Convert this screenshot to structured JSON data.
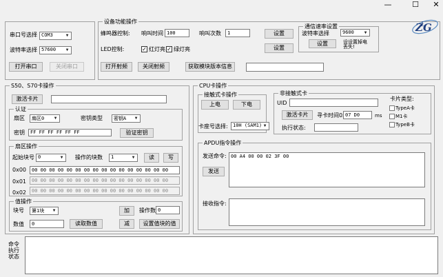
{
  "window": {
    "minimize_glyph": "—",
    "maximize_glyph": "☐",
    "close_glyph": "✕"
  },
  "serial": {
    "port_label": "串口号选择",
    "port_value": "COM3",
    "baud_label": "波特率选择",
    "baud_value": "57600",
    "open_label": "打开串口",
    "close_label": "关闭串口"
  },
  "device": {
    "title": "设备功能操作",
    "buzzer_label": "蜂鸣器控制:",
    "time_label": "响叫时间",
    "time_value": "100",
    "count_label": "响叫次数",
    "count_value": "1",
    "set_label": "设置",
    "led_label": "LED控制:",
    "red_label": "红灯亮",
    "green_label": "绿灯亮",
    "led_set_label": "设置",
    "rf_on_label": "打开射频",
    "rf_off_label": "关闭射频",
    "version_label": "获取模块版本信息",
    "version_value": ""
  },
  "comm": {
    "title": "通信速率设置",
    "baud_label": "波特率选择",
    "baud_value": "9600",
    "set_label": "设置",
    "note_text": "设设置掉电丢失!"
  },
  "s50": {
    "title": "S50、S70卡操作",
    "activate_label": "激活卡片",
    "activate_value": "",
    "auth_title": "认证",
    "sector_label": "扇区",
    "sector_value": "扇区0",
    "key_type_label": "密钥类型",
    "key_type_value": "密钥A",
    "key_label": "密钥",
    "key_value": "FF FF FF FF FF FF",
    "verify_label": "验证密钥",
    "sector_op_title": "扇区操作",
    "start_block_label": "起始块号",
    "start_block_value": "0",
    "block_count_label": "操作的块数",
    "block_count_value": "1",
    "read_label": "读",
    "write_label": "写",
    "rows": [
      {
        "label": "0x00",
        "value": "00 00 00 00 00 00 00 00 00 00 00 00 00 00 00 00"
      },
      {
        "label": "0x01",
        "value": "00 00 00 00 00 00 00 00 00 00 00 00 00 00 00 00"
      },
      {
        "label": "0x02",
        "value": "00 00 00 00 00 00 00 00 00 00 00 00 00 00 00 00"
      }
    ],
    "value_op_title": "值操作",
    "block_no_label": "块号",
    "block_no_value": "第1块",
    "num_label": "数值",
    "num_value": "0",
    "add_label": "加",
    "op_count_label": "操作数",
    "op_count_value": "0",
    "read_value_label": "读取数值",
    "sub_label": "减",
    "set_value_label": "设置值块的值"
  },
  "cpu": {
    "title": "CPU卡操作",
    "contact_title": "接触式卡操作",
    "power_on_label": "上电",
    "power_off_label": "下电",
    "slot_label": "卡座号选择:",
    "slot_value": "10H (SAM1)",
    "noncontact_title": "非接触式卡",
    "uid_label": "UID",
    "uid_value": "",
    "activate_label": "激活卡片",
    "timeout_label": "寻卡时间0x",
    "timeout_value": "07 D0",
    "ms_label": "ms",
    "status_label": "执行状态:",
    "status_value": "",
    "card_type_title": "卡片类型:",
    "type_a_label": "TypeA卡",
    "m1_label": "M1卡",
    "type_b_label": "TypeB卡",
    "apdu_title": "APDU指令操作",
    "send_cmd_label": "发送命令:",
    "send_cmd_value": "00 A4 00 00 02 3F 00",
    "send_label": "发送",
    "recv_label": "接收指令:",
    "recv_value": ""
  },
  "log": {
    "label_line1": "命令",
    "label_line2": "执行",
    "label_line3": "状态",
    "value": ""
  }
}
